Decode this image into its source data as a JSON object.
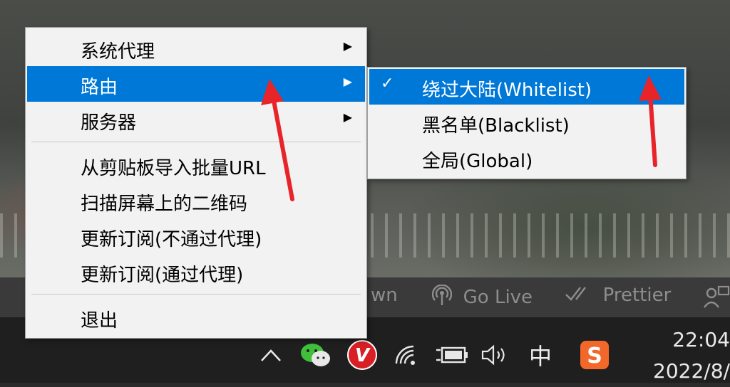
{
  "statusbar": {
    "items": [
      {
        "icon": "broadcast-icon",
        "label": "wn"
      },
      {
        "icon": "broadcast-icon",
        "label": "Go Live"
      },
      {
        "icon": "double-check-icon",
        "label": "Prettier"
      }
    ]
  },
  "menu": {
    "items": [
      {
        "label": "系统代理",
        "submenu": true
      },
      {
        "label": "路由",
        "submenu": true,
        "highlighted": true
      },
      {
        "label": "服务器",
        "submenu": true
      },
      {
        "label": "从剪贴板导入批量URL"
      },
      {
        "label": "扫描屏幕上的二维码"
      },
      {
        "label": "更新订阅(不通过代理)"
      },
      {
        "label": "更新订阅(通过代理)"
      },
      {
        "label": "退出"
      }
    ]
  },
  "submenu": {
    "items": [
      {
        "label": "绕过大陆(Whitelist)",
        "checked": true,
        "highlighted": true
      },
      {
        "label": "黑名单(Blacklist)"
      },
      {
        "label": "全局(Global)"
      }
    ]
  },
  "taskbar": {
    "tray_icons": [
      "chevron-up-icon",
      "wechat-icon",
      "v2ray-icon",
      "wifi-icon",
      "battery-icon",
      "volume-icon",
      "ime-indicator",
      "sogou-icon"
    ],
    "ime_label": "中",
    "v2ray_label": "V",
    "sogou_label": "S",
    "time": "22:04",
    "date": "2022/8/"
  },
  "colors": {
    "highlight": "#0078d7",
    "arrow": "#e8242b",
    "menu_bg": "#f2f2f2"
  }
}
